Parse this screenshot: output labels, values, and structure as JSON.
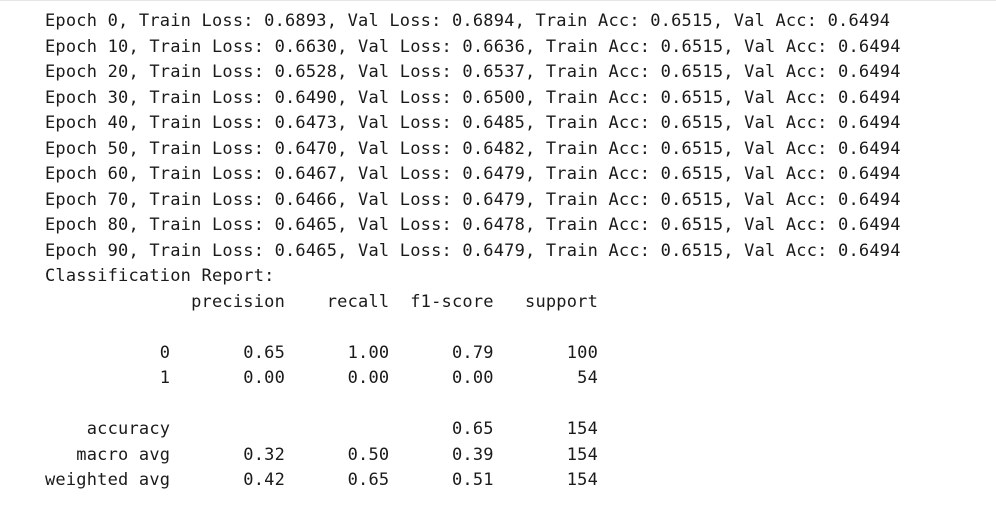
{
  "training_log": [
    "Epoch 0, Train Loss: 0.6893, Val Loss: 0.6894, Train Acc: 0.6515, Val Acc: 0.6494",
    "Epoch 10, Train Loss: 0.6630, Val Loss: 0.6636, Train Acc: 0.6515, Val Acc: 0.6494",
    "Epoch 20, Train Loss: 0.6528, Val Loss: 0.6537, Train Acc: 0.6515, Val Acc: 0.6494",
    "Epoch 30, Train Loss: 0.6490, Val Loss: 0.6500, Train Acc: 0.6515, Val Acc: 0.6494",
    "Epoch 40, Train Loss: 0.6473, Val Loss: 0.6485, Train Acc: 0.6515, Val Acc: 0.6494",
    "Epoch 50, Train Loss: 0.6470, Val Loss: 0.6482, Train Acc: 0.6515, Val Acc: 0.6494",
    "Epoch 60, Train Loss: 0.6467, Val Loss: 0.6479, Train Acc: 0.6515, Val Acc: 0.6494",
    "Epoch 70, Train Loss: 0.6466, Val Loss: 0.6479, Train Acc: 0.6515, Val Acc: 0.6494",
    "Epoch 80, Train Loss: 0.6465, Val Loss: 0.6478, Train Acc: 0.6515, Val Acc: 0.6494",
    "Epoch 90, Train Loss: 0.6465, Val Loss: 0.6479, Train Acc: 0.6515, Val Acc: 0.6494"
  ],
  "report": {
    "title": "Classification Report:",
    "header": "              precision    recall  f1-score   support",
    "blank1": "",
    "row_0": "           0       0.65      1.00      0.79       100",
    "row_1": "           1       0.00      0.00      0.00        54",
    "blank2": "",
    "accuracy": "    accuracy                           0.65       154",
    "macro_avg": "   macro avg       0.32      0.50      0.39       154",
    "weighted_avg": "weighted avg       0.42      0.65      0.51       154"
  }
}
